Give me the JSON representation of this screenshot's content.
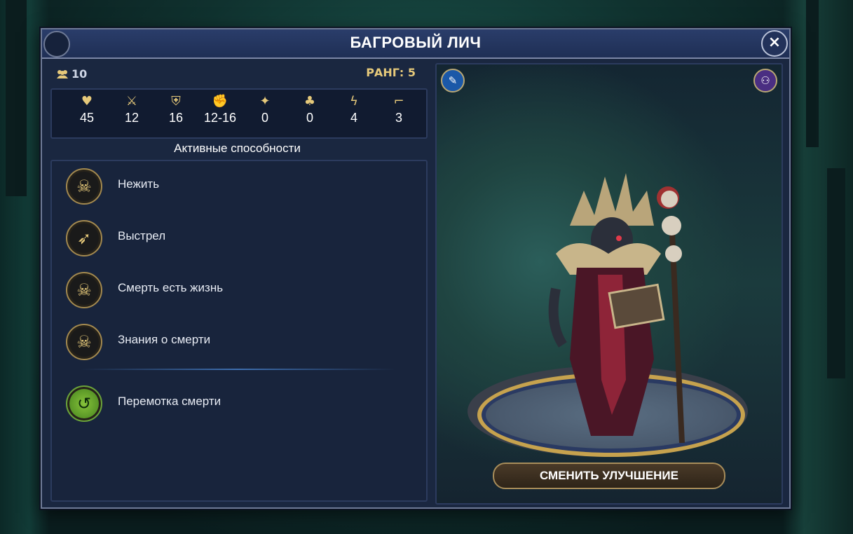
{
  "window": {
    "title": "БАГРОВЫЙ ЛИЧ",
    "close_icon": "×"
  },
  "squad": {
    "icon": "group-icon",
    "count": "10"
  },
  "rank": {
    "label": "РАНГ: 5"
  },
  "stats": [
    {
      "icon": "heart-plus-icon",
      "glyph": "♥",
      "value": "45"
    },
    {
      "icon": "crossed-swords-icon",
      "glyph": "⚔",
      "value": "12"
    },
    {
      "icon": "shield-icon",
      "glyph": "⛨",
      "value": "16"
    },
    {
      "icon": "fist-icon",
      "glyph": "✊",
      "value": "12-16"
    },
    {
      "icon": "winged-icon",
      "glyph": "✦",
      "value": "0"
    },
    {
      "icon": "clover-icon",
      "glyph": "♣",
      "value": "0"
    },
    {
      "icon": "lightning-icon",
      "glyph": "ϟ",
      "value": "4"
    },
    {
      "icon": "boot-icon",
      "glyph": "⌐",
      "value": "3"
    }
  ],
  "abilities_title": "Активные способности",
  "abilities": [
    {
      "icon": "skull-icon",
      "glyph": "☠",
      "label": "Нежить"
    },
    {
      "icon": "bow-icon",
      "glyph": "➶",
      "label": "Выстрел"
    },
    {
      "icon": "half-skull-icon",
      "glyph": "☠",
      "label": "Смерть есть жизнь"
    },
    {
      "icon": "skull-book-icon",
      "glyph": "☠",
      "label": "Знания о смерти"
    },
    {
      "icon": "rewind-icon",
      "glyph": "↺",
      "label": "Перемотка смерти"
    }
  ],
  "right": {
    "left_btn_icon": "feather-icon",
    "right_btn_icon": "swap-unit-icon"
  },
  "change_button": "СМЕНИТЬ УЛУЧШЕНИЕ"
}
